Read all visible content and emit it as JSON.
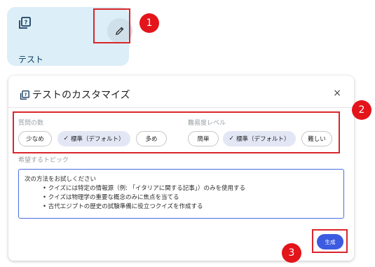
{
  "card": {
    "title": "テスト"
  },
  "markers": {
    "one": "1",
    "two": "2",
    "three": "3"
  },
  "dialog": {
    "title": "テストのカスタマイズ",
    "close_icon": "×",
    "question_count": {
      "label": "質問の数",
      "options": [
        "少なめ",
        "標準（デフォルト）",
        "多め"
      ],
      "selected": "標準（デフォルト）"
    },
    "difficulty": {
      "label": "難易度レベル",
      "options": [
        "簡単",
        "標準（デフォルト）",
        "難しい"
      ],
      "selected": "標準（デフォルト）"
    },
    "topic": {
      "label": "希望するトピック",
      "lines": [
        "次の方法をお試しください",
        "• クイズには特定の情報源（例: 「イタリアに関する記事」）のみを使用する",
        "• クイズは物理学の重要な概念のみに焦点を当てる",
        "• 古代エジプトの歴史の試験準備に役立つクイズを作成する"
      ]
    },
    "generate_label": "生成"
  },
  "colors": {
    "accent": "#3d5be0",
    "annotation_red": "#e3141a",
    "card_bg": "#dceef7"
  },
  "icons": {
    "card_icon": "quiz-icon",
    "edit": "pencil-icon",
    "close": "close-icon",
    "check": "check-icon"
  }
}
